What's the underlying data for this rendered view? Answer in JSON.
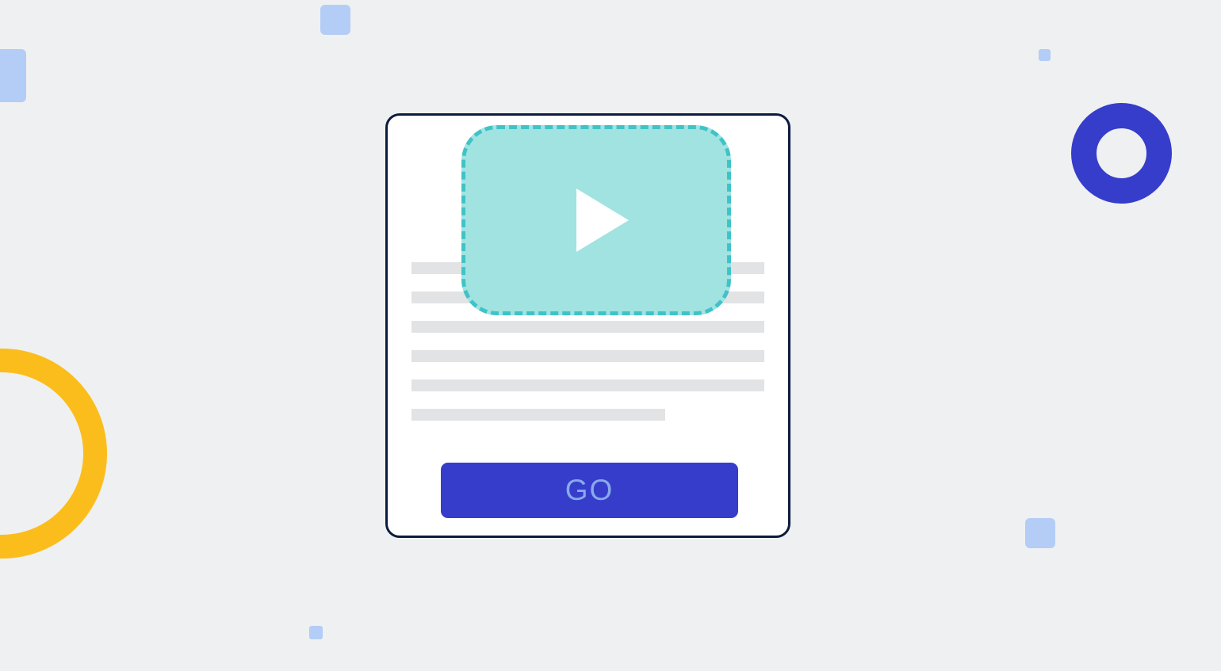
{
  "button": {
    "label": "GO"
  }
}
